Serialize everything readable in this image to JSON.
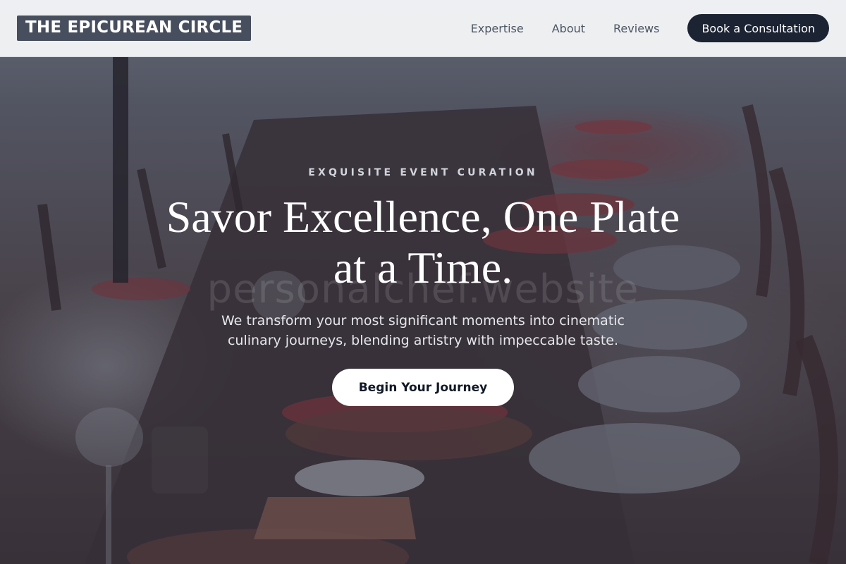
{
  "header": {
    "logo_text": "THE EPICUREAN CIRCLE",
    "nav": [
      {
        "label": "Expertise"
      },
      {
        "label": "About"
      },
      {
        "label": "Reviews"
      }
    ],
    "cta_label": "Book a Consultation"
  },
  "hero": {
    "eyebrow": "EXQUISITE EVENT CURATION",
    "title_line1": "Savor Excellence, One Plate",
    "title_line2": "at a Time.",
    "watermark": "personalchef.website",
    "subtitle_line1": "We transform your most significant moments into cinematic",
    "subtitle_line2": "culinary journeys, blending artistry with impeccable taste.",
    "button_label": "Begin Your Journey"
  },
  "colors": {
    "header_bg": "#f3f4f6",
    "logo_bg": "#474e5e",
    "cta_bg": "#1c2333",
    "hero_button_bg": "#ffffff",
    "hero_button_text": "#111827"
  }
}
